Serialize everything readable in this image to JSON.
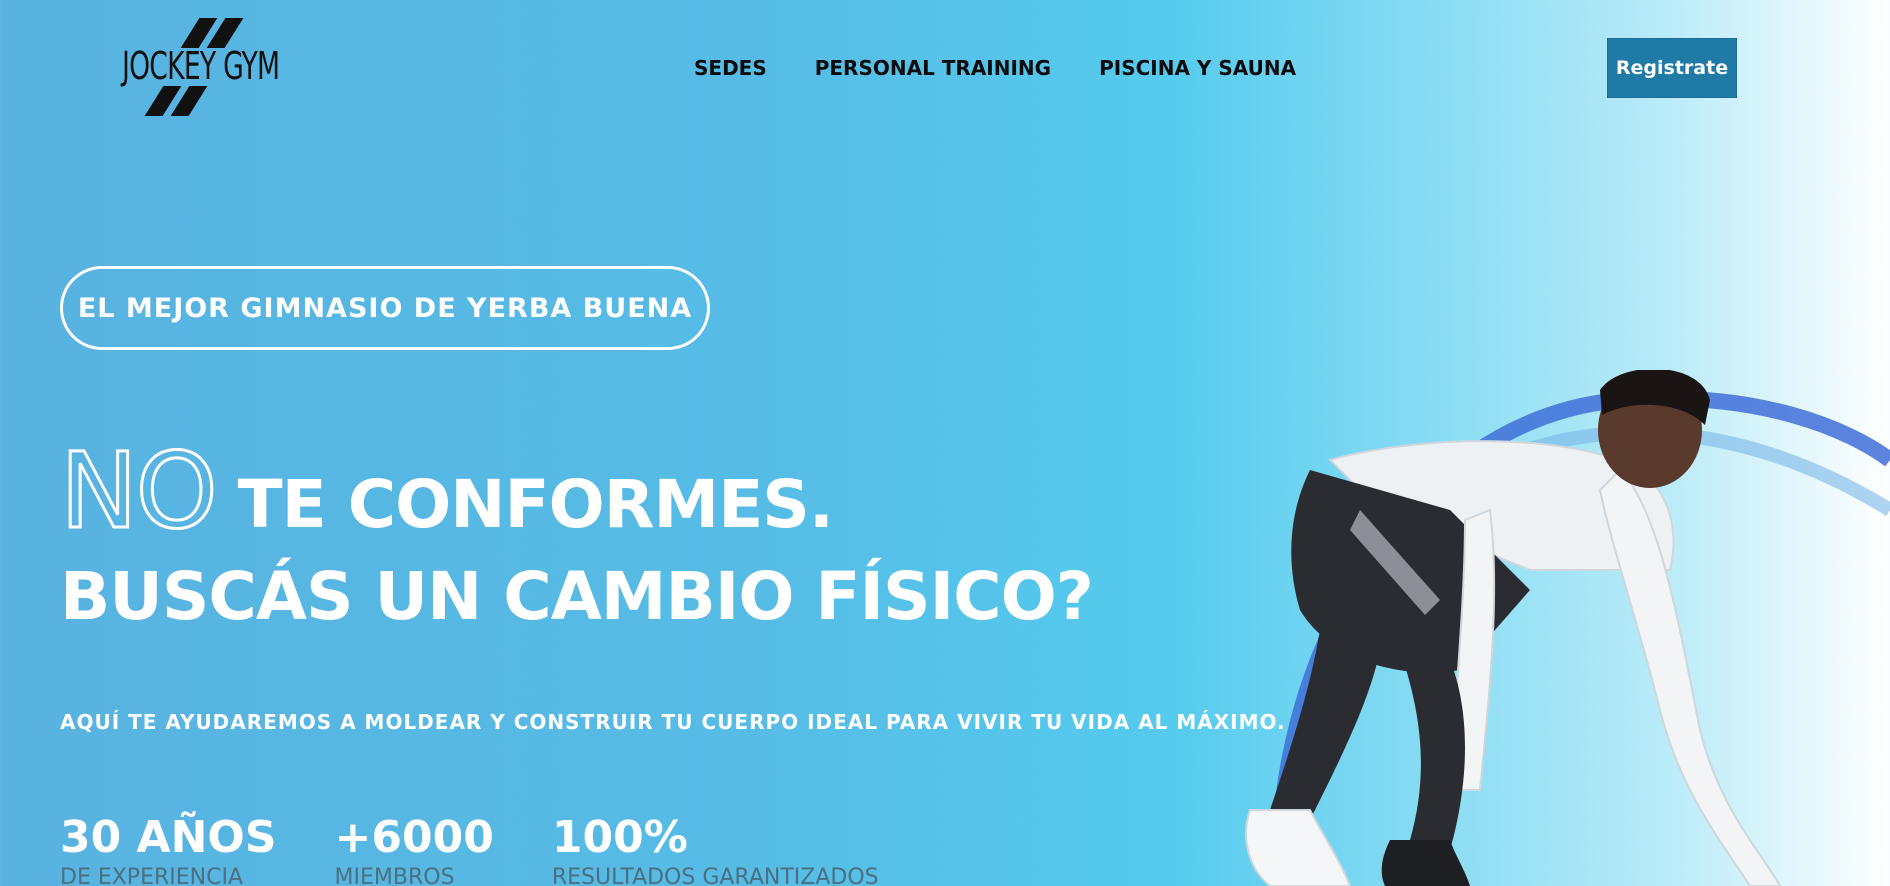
{
  "header": {
    "logo_text": "JOCKEY GYM",
    "nav": [
      {
        "label": "SEDES"
      },
      {
        "label": "PERSONAL TRAINING"
      },
      {
        "label": "PISCINA Y SAUNA"
      }
    ],
    "register_label": "Registrate"
  },
  "hero": {
    "badge": "EL MEJOR GIMNASIO DE YERBA BUENA",
    "headline_outline": "NO",
    "headline_line1": "TE CONFORMES.",
    "headline_line2": "BUSCÁS UN CAMBIO FÍSICO?",
    "subtitle": "AQUÍ TE AYUDAREMOS A MOLDEAR Y CONSTRUIR TU CUERPO IDEAL PARA VIVIR TU VIDA AL MÁXIMO.",
    "stats": [
      {
        "value": "30 AÑOS",
        "label": "DE EXPERIENCIA"
      },
      {
        "value": "+6000",
        "label": "MIEMBROS"
      },
      {
        "value": "100%",
        "label": "RESULTADOS GARANTIZADOS"
      }
    ]
  },
  "colors": {
    "background": "#56bce6",
    "button": "#1f7aa6",
    "text": "#ffffff",
    "nav_text": "#0b0b0b"
  }
}
